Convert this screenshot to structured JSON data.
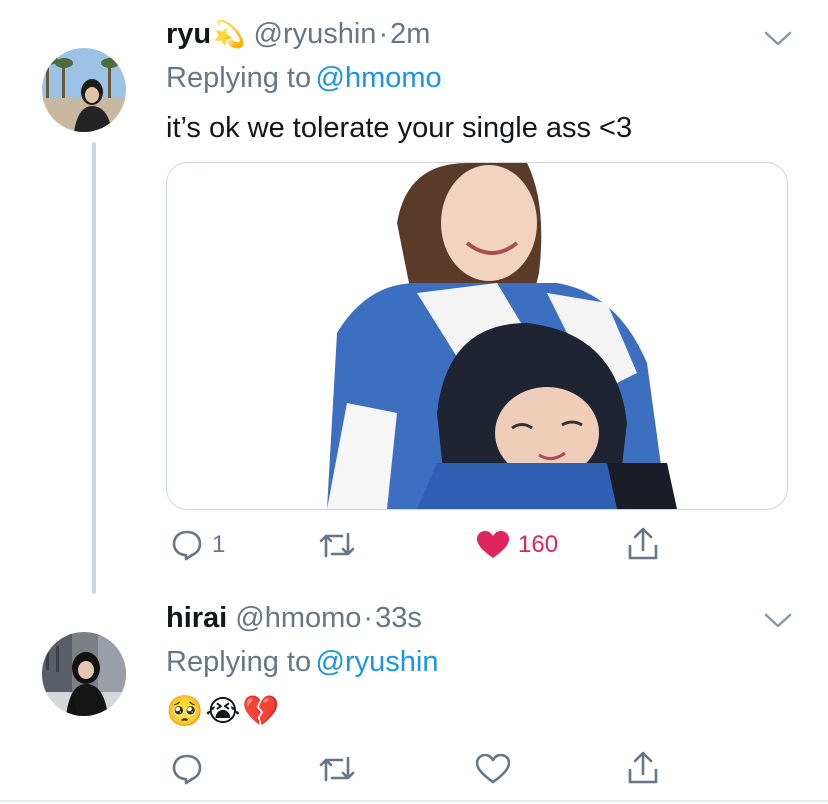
{
  "tweets": [
    {
      "display_name": "ryu",
      "name_emoji": "💫",
      "handle": "@ryushin",
      "separator": "·",
      "time": "2m",
      "replying_prefix": "Replying to",
      "replying_handle": "@hmomo",
      "text": "it’s ok we tolerate your single ass <3",
      "reply_count": "1",
      "retweet_count": "",
      "like_count": "160",
      "liked": true
    },
    {
      "display_name": "hirai",
      "handle": "@hmomo",
      "separator": "·",
      "time": "33s",
      "replying_prefix": "Replying to",
      "replying_handle": "@ryushin",
      "text": "🥺😭💔",
      "reply_count": "",
      "retweet_count": "",
      "like_count": "",
      "liked": false
    }
  ],
  "colors": {
    "link": "#1b95e0",
    "muted": "#657786",
    "like": "#e0245e",
    "border": "#ccd6dd"
  },
  "icons": [
    "chevron-down-icon",
    "reply-icon",
    "retweet-icon",
    "heart-icon",
    "share-icon"
  ]
}
